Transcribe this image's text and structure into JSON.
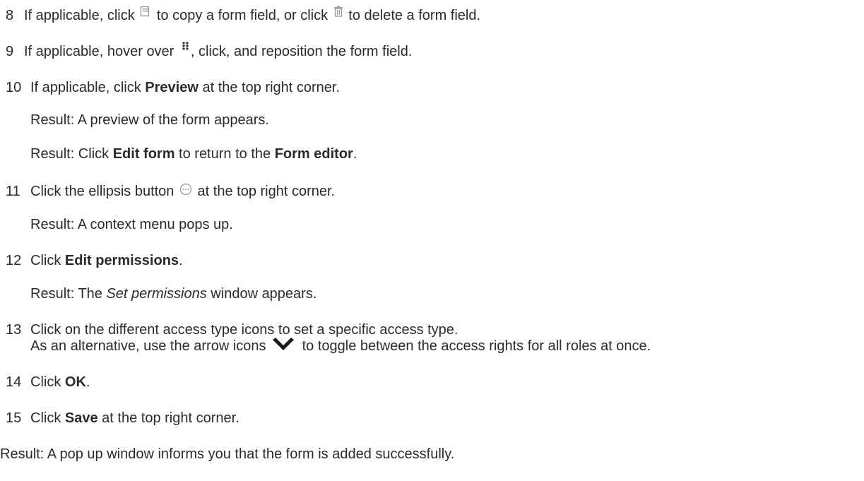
{
  "steps": [
    {
      "num": "8",
      "parts": [
        "If applicable, click ",
        " to copy a form field, or click ",
        " to delete a form field."
      ],
      "icons": [
        "copy-icon",
        "trash-icon"
      ]
    },
    {
      "num": "9",
      "parts": [
        "If applicable, hover over ",
        ", click, and reposition the form field."
      ],
      "icons": [
        "drag-handle-icon"
      ]
    },
    {
      "num": "10",
      "parts": [
        "If applicable, click ",
        "Preview",
        " at the top right corner."
      ],
      "results": [
        "Result: A preview of the form appears.",
        {
          "pre": "Result: Click ",
          "b1": "Edit form",
          "mid": " to return to the ",
          "b2": "Form editor",
          "post": "."
        }
      ]
    },
    {
      "num": "11",
      "parts": [
        "Click the ellipsis button ",
        " at the top right corner."
      ],
      "icons": [
        "ellipsis-icon"
      ],
      "results": [
        "Result: A context menu pops up."
      ]
    },
    {
      "num": "12",
      "parts": [
        "Click ",
        "Edit permissions",
        "."
      ],
      "results": [
        {
          "pre": "Result: The ",
          "i": "Set permissions",
          "post": " window appears."
        }
      ]
    },
    {
      "num": "13",
      "parts": [
        "Click on the different access type icons to set a specific access type."
      ],
      "continuation": [
        "As an alternative, use the arrow icons ",
        " to toggle between the access rights for all roles at once."
      ],
      "icons": [
        "chevron-down-icon"
      ]
    },
    {
      "num": "14",
      "parts": [
        "Click ",
        "OK",
        "."
      ]
    },
    {
      "num": "15",
      "parts": [
        "Click ",
        "Save",
        " at the top right corner."
      ]
    }
  ],
  "final_result": "Result: A pop up window informs you that the form is added successfully.",
  "colors": {
    "text": "#2b2b2b",
    "icon": "#9a9a9a",
    "chevron": "#1a1a1a"
  }
}
